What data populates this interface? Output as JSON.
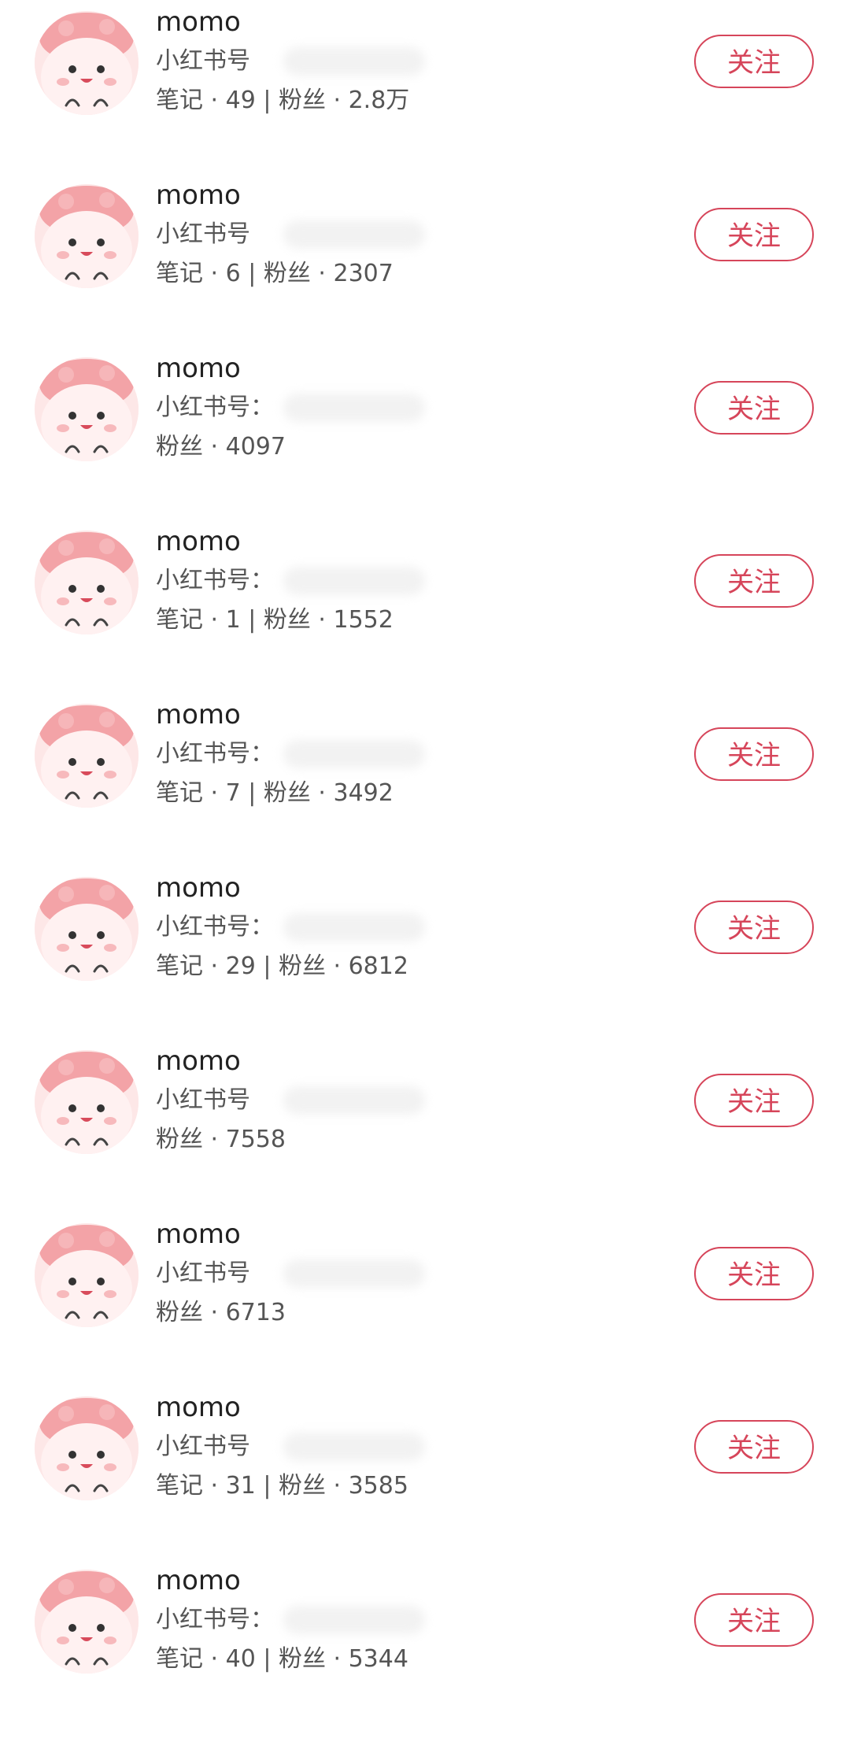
{
  "users": [
    {
      "name": "momo",
      "red_id_label": "小红书号",
      "stats": "笔记 · 49 | 粉丝 · 2.8万",
      "follow_label": "关注"
    },
    {
      "name": "momo",
      "red_id_label": "小红书号",
      "stats": "笔记 · 6 | 粉丝 · 2307",
      "follow_label": "关注"
    },
    {
      "name": "momo",
      "red_id_label": "小红书号：",
      "stats": "粉丝 · 4097",
      "follow_label": "关注"
    },
    {
      "name": "momo",
      "red_id_label": "小红书号：",
      "stats": "笔记 · 1 | 粉丝 · 1552",
      "follow_label": "关注"
    },
    {
      "name": "momo",
      "red_id_label": "小红书号：",
      "stats": "笔记 · 7 | 粉丝 · 3492",
      "follow_label": "关注"
    },
    {
      "name": "momo",
      "red_id_label": "小红书号：",
      "stats": "笔记 · 29 | 粉丝 · 6812",
      "follow_label": "关注"
    },
    {
      "name": "momo",
      "red_id_label": "小红书号",
      "stats": "粉丝 · 7558",
      "follow_label": "关注"
    },
    {
      "name": "momo",
      "red_id_label": "小红书号",
      "stats": "粉丝 · 6713",
      "follow_label": "关注"
    },
    {
      "name": "momo",
      "red_id_label": "小红书号",
      "stats": "笔记 · 31 | 粉丝 · 3585",
      "follow_label": "关注"
    },
    {
      "name": "momo",
      "red_id_label": "小红书号：",
      "stats": "笔记 · 40 | 粉丝 · 5344",
      "follow_label": "关注"
    }
  ],
  "colors": {
    "accent": "#d6455a",
    "avatar_bg": "#fde7e7",
    "text_primary": "#222222",
    "text_secondary": "#555555"
  },
  "icons": {
    "avatar": "pink-blob-avatar-icon"
  }
}
